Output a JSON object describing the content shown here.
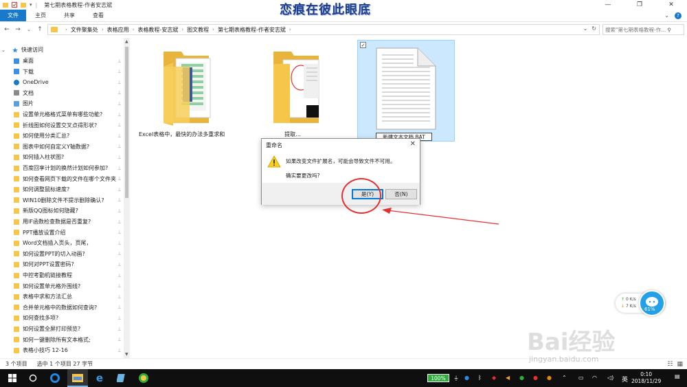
{
  "window": {
    "title": "第七期表格教程-作者安志斌",
    "watermark_top": "恋痕在彼此眼底"
  },
  "ribbon": {
    "tabs": [
      "文件",
      "主页",
      "共享",
      "查看"
    ]
  },
  "address": {
    "crumbs": [
      "文件聚集处",
      "表格应用",
      "表格教程-安志斌",
      "图文教程",
      "第七期表格教程-作者安志斌"
    ],
    "search_placeholder": "搜索\"第七期表格教程-作..."
  },
  "sidebar": {
    "quick_access": "快速访问",
    "items": [
      {
        "label": "桌面",
        "icon": "desktop-icon",
        "pinned": true
      },
      {
        "label": "下载",
        "icon": "download-icon",
        "pinned": true
      },
      {
        "label": "OneDrive",
        "icon": "onedrive-icon",
        "pinned": true
      },
      {
        "label": "文档",
        "icon": "documents-icon",
        "pinned": true
      },
      {
        "label": "图片",
        "icon": "pictures-icon",
        "pinned": true
      },
      {
        "label": "设置单元格格式菜单有哪些功能?",
        "icon": "folder-icon",
        "pinned": true
      },
      {
        "label": "折线图如何设置交叉点得形状?",
        "icon": "folder-icon",
        "pinned": true
      },
      {
        "label": "如何使用分类汇总?",
        "icon": "folder-icon",
        "pinned": true
      },
      {
        "label": "图表中如何自定义Y轴数据?",
        "icon": "folder-icon",
        "pinned": true
      },
      {
        "label": "如何插入柱状图?",
        "icon": "folder-icon",
        "pinned": true
      },
      {
        "label": "百度回享计划的换然计划如何参加?",
        "icon": "folder-icon",
        "pinned": true
      },
      {
        "label": "如何查看网页下载的文件在哪个文件夹",
        "icon": "folder-icon",
        "pinned": true
      },
      {
        "label": "如何调整鼠标速度?",
        "icon": "folder-icon",
        "pinned": true
      },
      {
        "label": "WIN10删除文件不提示删除确认?",
        "icon": "folder-icon",
        "pinned": true
      },
      {
        "label": "新版QQ图标如何隐藏?",
        "icon": "folder-icon",
        "pinned": true
      },
      {
        "label": "用IF函数检查数据是否重复?",
        "icon": "folder-icon",
        "pinned": true
      },
      {
        "label": "PPT播放设置介绍",
        "icon": "folder-icon",
        "pinned": true
      },
      {
        "label": "Word文档插入页头，页尾，",
        "icon": "folder-icon",
        "pinned": true
      },
      {
        "label": "如何设置PPT的切入动画?",
        "icon": "folder-icon",
        "pinned": true
      },
      {
        "label": "如何对PPT设置密码?",
        "icon": "folder-icon",
        "pinned": true
      },
      {
        "label": "中控考勤机链接教程",
        "icon": "folder-icon",
        "pinned": true
      },
      {
        "label": "如何设置单元格外围线?",
        "icon": "folder-icon",
        "pinned": true
      },
      {
        "label": "表格中求和方法汇总",
        "icon": "folder-icon",
        "pinned": true
      },
      {
        "label": "合并单元格中的数据如何查询?",
        "icon": "folder-icon",
        "pinned": true
      },
      {
        "label": "如何查找多项?",
        "icon": "folder-icon",
        "pinned": true
      },
      {
        "label": "如何设置全屏打印预览?",
        "icon": "folder-icon",
        "pinned": true
      },
      {
        "label": "如何一键删除所有文本格式;",
        "icon": "folder-icon",
        "pinned": true
      },
      {
        "label": "表格小技巧 12-16",
        "icon": "folder-icon",
        "pinned": true
      }
    ]
  },
  "files": [
    {
      "name": "Excel表格中，最快的办法多重求和",
      "type": "folder"
    },
    {
      "name": "提取...",
      "type": "folder"
    },
    {
      "name": "新建文本文档.BAT",
      "type": "text-file",
      "selected": true
    }
  ],
  "dialog": {
    "title": "重命名",
    "message": "如果改变文件扩展名，可能会导致文件不可用。",
    "question": "确实要更改吗?",
    "yes_label": "是(Y)",
    "no_label": "否(N)"
  },
  "status": {
    "count": "3 个项目",
    "selected": "选中 1 个项目  27 字节"
  },
  "taskbar": {
    "battery": "100%",
    "ime": "英",
    "time": "0:10",
    "date": "2018/11/29"
  },
  "netwidget": {
    "up": "0  K/s",
    "down": "7  K/s",
    "percent": "61%"
  },
  "watermark": {
    "brand": "Bai经验",
    "url": "jingyan.baidu.com"
  },
  "colors": {
    "accent": "#1979ca",
    "folder": "#f5c649",
    "selection": "#cce8ff",
    "annotation_red": "#e53030"
  }
}
